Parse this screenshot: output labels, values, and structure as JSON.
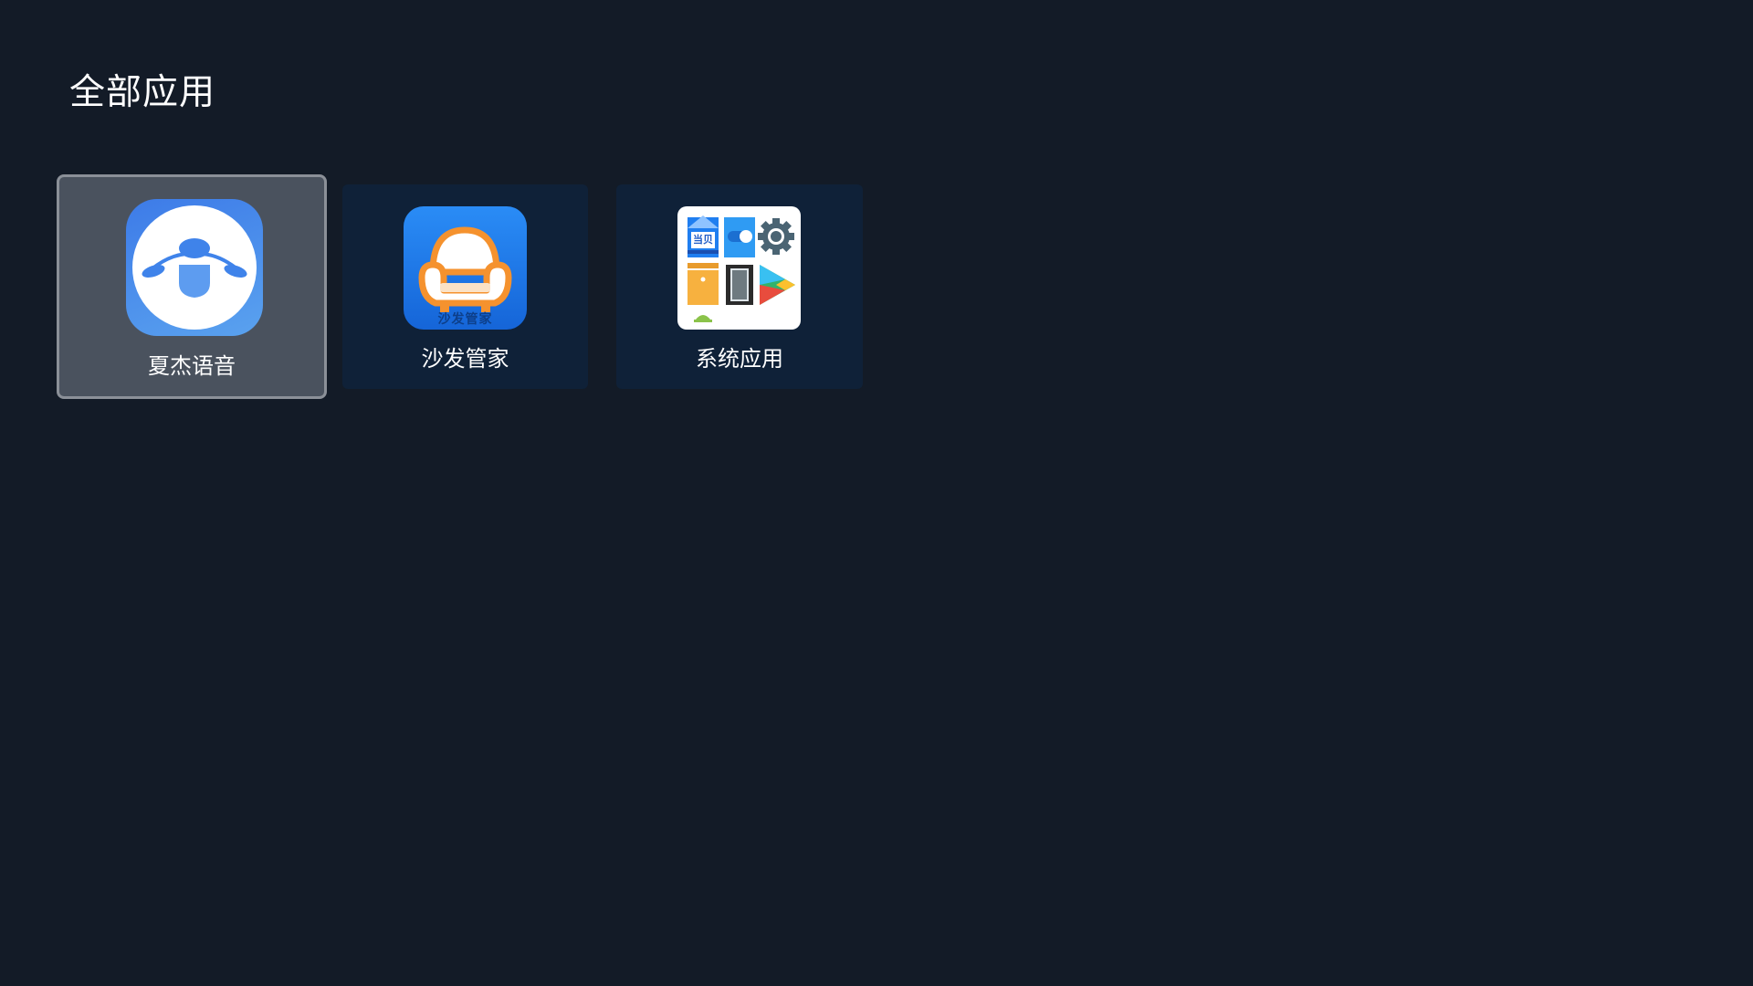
{
  "page": {
    "title": "全部应用"
  },
  "apps": [
    {
      "name": "夏杰语音",
      "icon": "voice-assistant-icon",
      "focused": true
    },
    {
      "name": "沙发管家",
      "icon": "sofa-icon",
      "focused": false,
      "icon_text": "沙发管家"
    },
    {
      "name": "系统应用",
      "icon": "system-apps-folder-icon",
      "focused": false,
      "icon_text": "当贝"
    }
  ],
  "colors": {
    "background": "#131b27",
    "tile": "#0f2138",
    "tile_focused": "#4a525e",
    "focus_border": "#8b9098",
    "accent_blue": "#1f7ef0",
    "accent_orange": "#f5922e"
  }
}
